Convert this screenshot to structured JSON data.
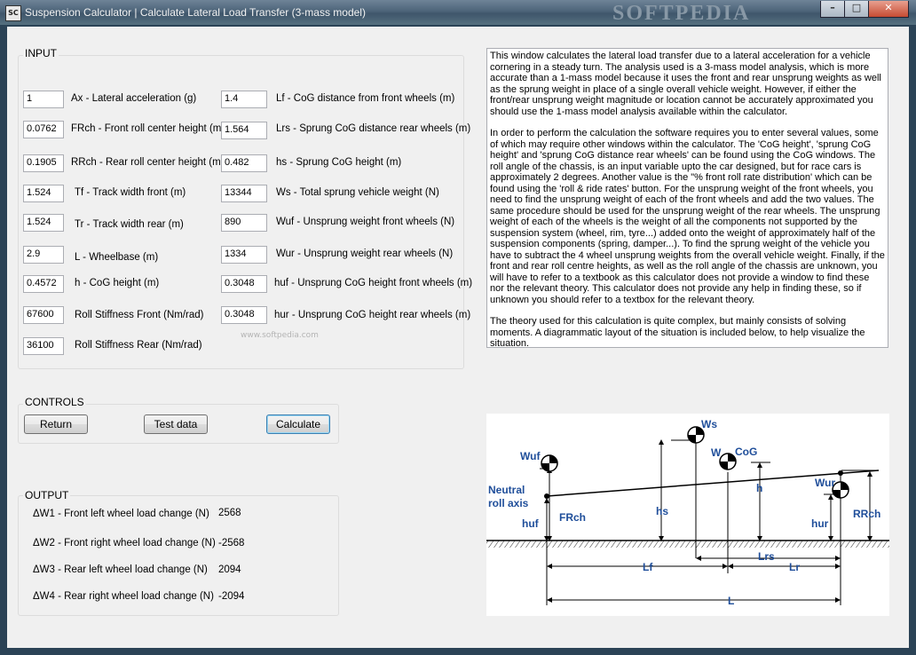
{
  "window": {
    "title": "Suspension Calculator | Calculate Lateral Load Transfer (3-mass model)",
    "icon_text": "SC",
    "watermark": "SOFTPEDIA",
    "buttons": {
      "minimize": "–",
      "maximize": "□",
      "close": "✕"
    }
  },
  "input": {
    "title": "INPUT",
    "fields": [
      {
        "value": "1",
        "label": "Ax - Lateral acceleration (g)"
      },
      {
        "value": "0.0762",
        "label": "FRch - Front roll center height (m)"
      },
      {
        "value": "0.1905",
        "label": "RRch - Rear roll center height (m)"
      },
      {
        "value": "1.524",
        "label": "Tf - Track width front (m)"
      },
      {
        "value": "1.524",
        "label": "Tr - Track width rear (m)"
      },
      {
        "value": "2.9",
        "label": "L - Wheelbase (m)"
      },
      {
        "value": "0.4572",
        "label": "h - CoG height (m)"
      },
      {
        "value": "67600",
        "label": "Roll Stiffness Front (Nm/rad)"
      },
      {
        "value": "36100",
        "label": "Roll Stiffness Rear (Nm/rad)"
      },
      {
        "value": "1.4",
        "label": "Lf - CoG distance from front wheels (m)"
      },
      {
        "value": "1.564",
        "label": "Lrs - Sprung CoG distance rear wheels (m)"
      },
      {
        "value": "0.482",
        "label": "hs - Sprung CoG height (m)"
      },
      {
        "value": "13344",
        "label": "Ws - Total sprung vehicle weight (N)"
      },
      {
        "value": "890",
        "label": "Wuf - Unsprung weight front wheels (N)"
      },
      {
        "value": "1334",
        "label": "Wur - Unsprung weight rear wheels (N)"
      },
      {
        "value": "0.3048",
        "label": "huf - Unsprung CoG height front wheels (m)"
      },
      {
        "value": "0.3048",
        "label": "hur - Unsprung CoG height rear wheels (m)"
      }
    ],
    "watermark": "www.softpedia.com"
  },
  "controls": {
    "title": "CONTROLS",
    "return_label": "Return",
    "test_label": "Test data",
    "calculate_label": "Calculate"
  },
  "output": {
    "title": "OUTPUT",
    "rows": [
      {
        "label": "ΔW1 - Front left wheel load change (N)",
        "value": "2568"
      },
      {
        "label": "ΔW2 - Front right wheel load change (N)",
        "value": "-2568"
      },
      {
        "label": "ΔW3 - Rear left wheel load change (N)",
        "value": "2094"
      },
      {
        "label": "ΔW4 - Rear right wheel load change (N)",
        "value": "-2094"
      }
    ]
  },
  "description": {
    "paragraphs": [
      "This window calculates the lateral load transfer due to a lateral acceleration for a vehicle cornering in a steady turn. The analysis used is a 3-mass model analysis, which is more accurate than a 1-mass model because it uses the front and rear unsprung weights as well as the sprung weight in place of a single overall vehicle weight. However, if either the front/rear unsprung weight magnitude or location cannot be accurately approximated you should use the 1-mass model analysis available within the calculator.",
      "In order to perform the calculation the software requires you to enter several values, some of which may require other windows within the calculator. The 'CoG height', 'sprung CoG height' and 'sprung CoG distance rear wheels' can be found using the CoG windows. The roll angle of the chassis, is an input variable upto the car designed, but for race cars is approximately 2 degrees. Another value is the \"% front roll rate distribution' which can be found using the 'roll & ride rates' button. For the unsprung weight of the front wheels, you need to find the unsprung weight of each of the front wheels and add the two values. The same procedure should be used for the unsprung weight of the rear wheels. The unsprung weight of each of the wheels is the weight of all the components not supported by the suspension system (wheel, rim, tyre...) added onto the weight of approximately half of the suspension components (spring, damper...). To find the sprung weight of the vehicle you have to subtract the 4 wheel unsprung weights from the overall vehicle weight. Finally, if the front and rear roll centre heights, as well as the roll angle of the chassis are unknown, you will have to refer to a textbook as this calculator does not provide a window to find these nor the relevant theory. This calculator does not provide any help in finding these, so if unknown you should refer to a textbox for the relevant theory.",
      "The theory used for this calculation is quite complex, but mainly consists of solving moments. A diagrammatic layout of the situation is included below, to help visualize the situation."
    ]
  },
  "diagram": {
    "labels": {
      "wuf": "Wuf",
      "ws": "Ws",
      "w": "W",
      "cog": "CoG",
      "wur": "Wur",
      "neutral1": "Neutral",
      "neutral2": "roll axis",
      "frch": "FRch",
      "rrch": "RRch",
      "hs": "hs",
      "h": "h",
      "huf": "huf",
      "hur": "hur",
      "lf": "Lf",
      "lr": "Lr",
      "lrs": "Lrs",
      "l": "L"
    },
    "colors": {
      "label": "#1f4e9a",
      "line": "#000000"
    }
  }
}
